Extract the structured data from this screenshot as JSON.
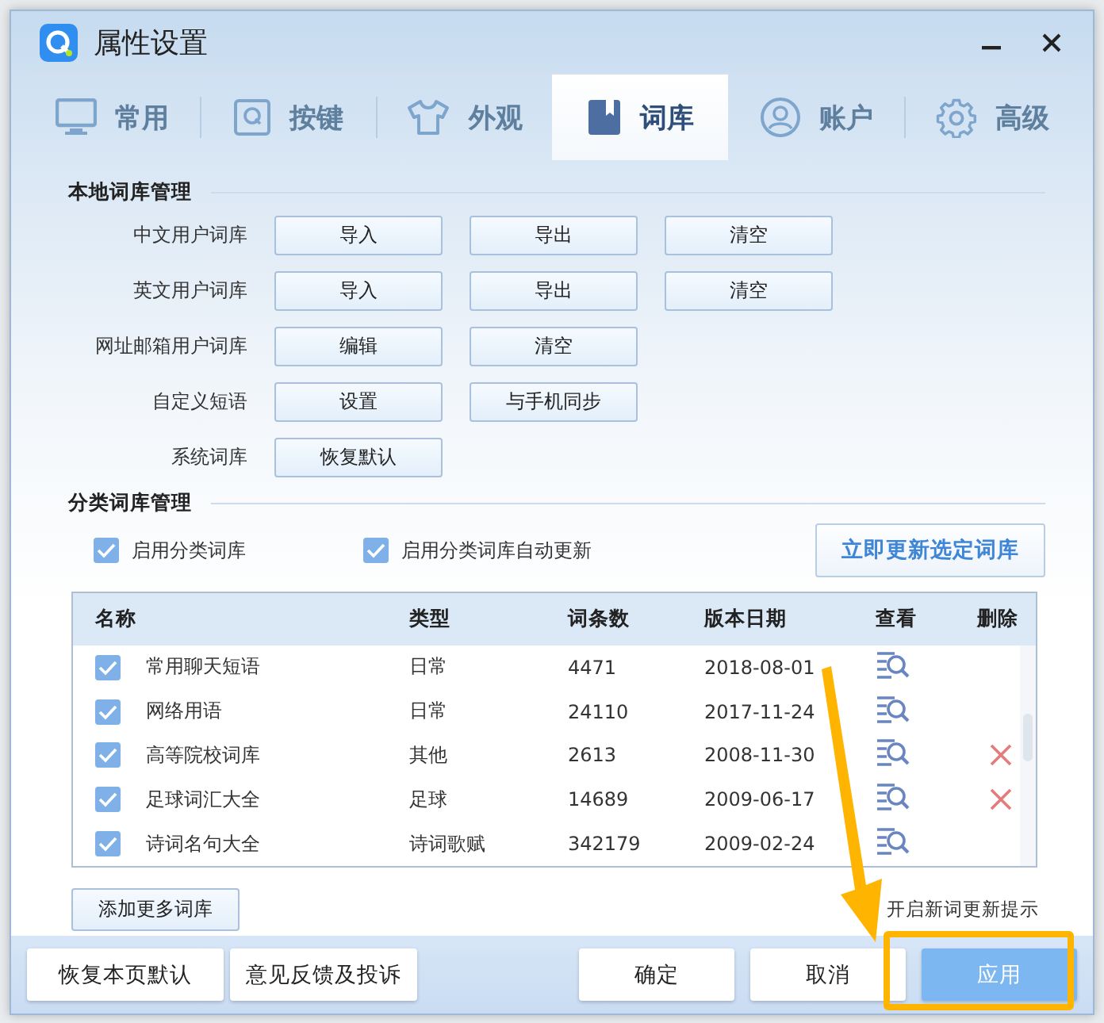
{
  "window": {
    "title": "属性设置"
  },
  "tabs": [
    {
      "label": "常用",
      "selected": false
    },
    {
      "label": "按键",
      "selected": false
    },
    {
      "label": "外观",
      "selected": false
    },
    {
      "label": "词库",
      "selected": true
    },
    {
      "label": "账户",
      "selected": false
    },
    {
      "label": "高级",
      "selected": false
    }
  ],
  "local_section": {
    "title": "本地词库管理",
    "rows": [
      {
        "label": "中文用户词库",
        "buttons": [
          "导入",
          "导出",
          "清空"
        ]
      },
      {
        "label": "英文用户词库",
        "buttons": [
          "导入",
          "导出",
          "清空"
        ]
      },
      {
        "label": "网址邮箱用户词库",
        "buttons": [
          "编辑",
          "清空"
        ]
      },
      {
        "label": "自定义短语",
        "buttons": [
          "设置",
          "与手机同步"
        ]
      },
      {
        "label": "系统词库",
        "buttons": [
          "恢复默认"
        ]
      }
    ]
  },
  "category_section": {
    "title": "分类词库管理",
    "options": [
      {
        "label": "启用分类词库",
        "checked": true
      },
      {
        "label": "启用分类词库自动更新",
        "checked": true
      }
    ],
    "update_button": "立即更新选定词库",
    "table": {
      "columns": [
        "名称",
        "类型",
        "词条数",
        "版本日期",
        "查看",
        "删除"
      ],
      "rows": [
        {
          "checked": true,
          "name": "常用聊天短语",
          "type": "日常",
          "count": "4471",
          "date": "2018-08-01",
          "deletable": false
        },
        {
          "checked": true,
          "name": "网络用语",
          "type": "日常",
          "count": "24110",
          "date": "2017-11-24",
          "deletable": false
        },
        {
          "checked": true,
          "name": "高等院校词库",
          "type": "其他",
          "count": "2613",
          "date": "2008-11-30",
          "deletable": true
        },
        {
          "checked": true,
          "name": "足球词汇大全",
          "type": "足球",
          "count": "14689",
          "date": "2009-06-17",
          "deletable": true
        },
        {
          "checked": true,
          "name": "诗词名句大全",
          "type": "诗词歌赋",
          "count": "342179",
          "date": "2009-02-24",
          "deletable": false
        }
      ]
    },
    "add_button": "添加更多词库",
    "update_hint": "开启新词更新提示"
  },
  "footer": {
    "left_buttons": [
      "恢复本页默认",
      "意见反馈及投诉"
    ],
    "right_buttons": [
      {
        "label": "确定",
        "primary": false
      },
      {
        "label": "取消",
        "primary": false
      },
      {
        "label": "应用",
        "primary": true
      }
    ]
  }
}
